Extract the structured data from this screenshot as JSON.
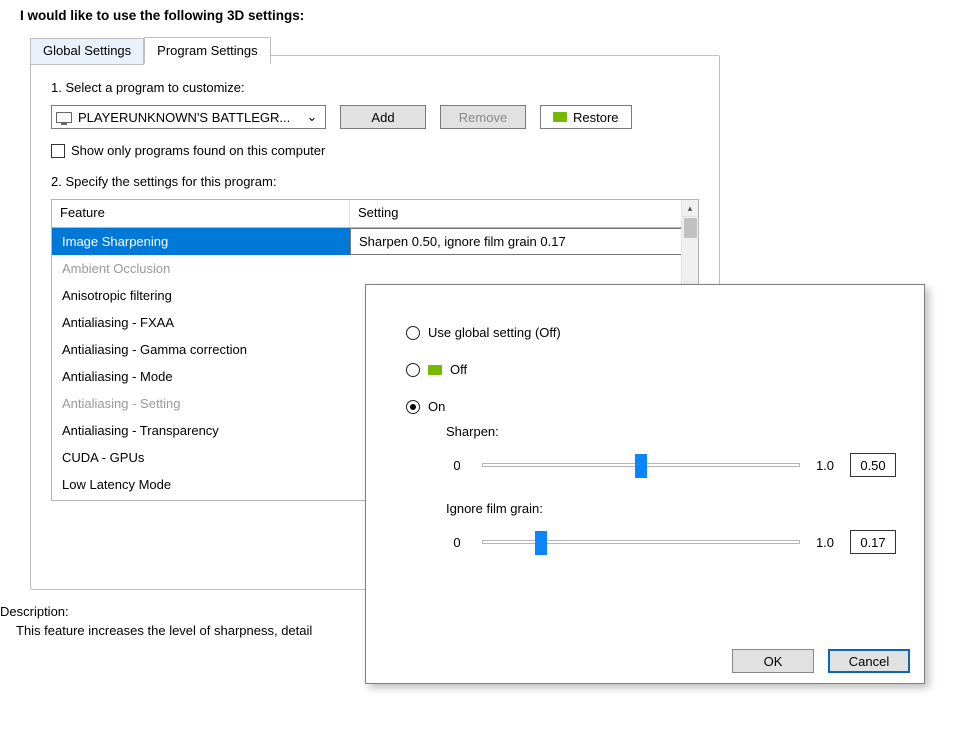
{
  "heading": "I would like to use the following 3D settings:",
  "tabs": {
    "global": "Global Settings",
    "program": "Program Settings"
  },
  "step1": {
    "label": "1. Select a program to customize:",
    "program": "PLAYERUNKNOWN'S BATTLEGR...",
    "add": "Add",
    "remove": "Remove",
    "restore": "Restore",
    "show_only": "Show only programs found on this computer"
  },
  "step2": {
    "label": "2. Specify the settings for this program:",
    "cols": {
      "feature": "Feature",
      "setting": "Setting"
    },
    "features": [
      {
        "name": "Image Sharpening",
        "setting": "Sharpen 0.50, ignore film grain 0.17",
        "selected": true
      },
      {
        "name": "Ambient Occlusion",
        "dim": true
      },
      {
        "name": "Anisotropic filtering"
      },
      {
        "name": "Antialiasing - FXAA"
      },
      {
        "name": "Antialiasing - Gamma correction"
      },
      {
        "name": "Antialiasing - Mode"
      },
      {
        "name": "Antialiasing - Setting",
        "dim": true
      },
      {
        "name": "Antialiasing - Transparency"
      },
      {
        "name": "CUDA - GPUs"
      },
      {
        "name": "Low Latency Mode"
      }
    ]
  },
  "description": {
    "label": "Description:",
    "text": "This feature increases the level of sharpness, detail"
  },
  "popup": {
    "opt_global": "Use global setting (Off)",
    "opt_off": "Off",
    "opt_on": "On",
    "sharpen": {
      "label": "Sharpen:",
      "min": "0",
      "max": "1.0",
      "value": "0.50",
      "pct": 50
    },
    "grain": {
      "label": "Ignore film grain:",
      "min": "0",
      "max": "1.0",
      "value": "0.17",
      "pct": 17
    },
    "ok": "OK",
    "cancel": "Cancel"
  }
}
